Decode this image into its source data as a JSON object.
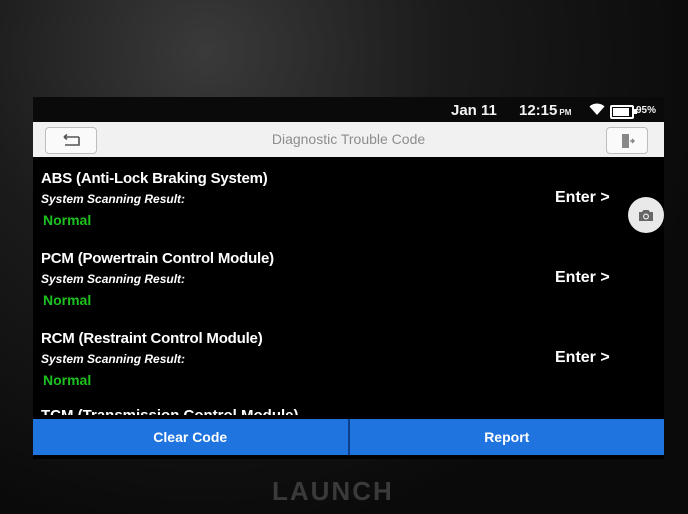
{
  "status": {
    "date": "Jan 11",
    "time": "12:15",
    "ampm": "PM",
    "battery": "95%"
  },
  "titlebar": {
    "title": "Diagnostic Trouble Code"
  },
  "systems": [
    {
      "name": "ABS (Anti-Lock Braking System)",
      "result_label": "System Scanning Result:",
      "status": "Normal",
      "action": "Enter >"
    },
    {
      "name": "PCM (Powertrain Control Module)",
      "result_label": "System Scanning Result:",
      "status": "Normal",
      "action": "Enter >"
    },
    {
      "name": "RCM (Restraint Control Module)",
      "result_label": "System Scanning Result:",
      "status": "Normal",
      "action": "Enter >"
    }
  ],
  "partial_system": "TCM (Transmission Control Module)",
  "buttons": {
    "clear": "Clear Code",
    "report": "Report"
  },
  "brand": "LAUNCH",
  "colors": {
    "accent": "#1f74e0",
    "normal": "#1ec21e"
  },
  "icons": [
    "back-arrow-icon",
    "exit-icon",
    "camera-icon",
    "wifi-icon",
    "battery-icon"
  ]
}
